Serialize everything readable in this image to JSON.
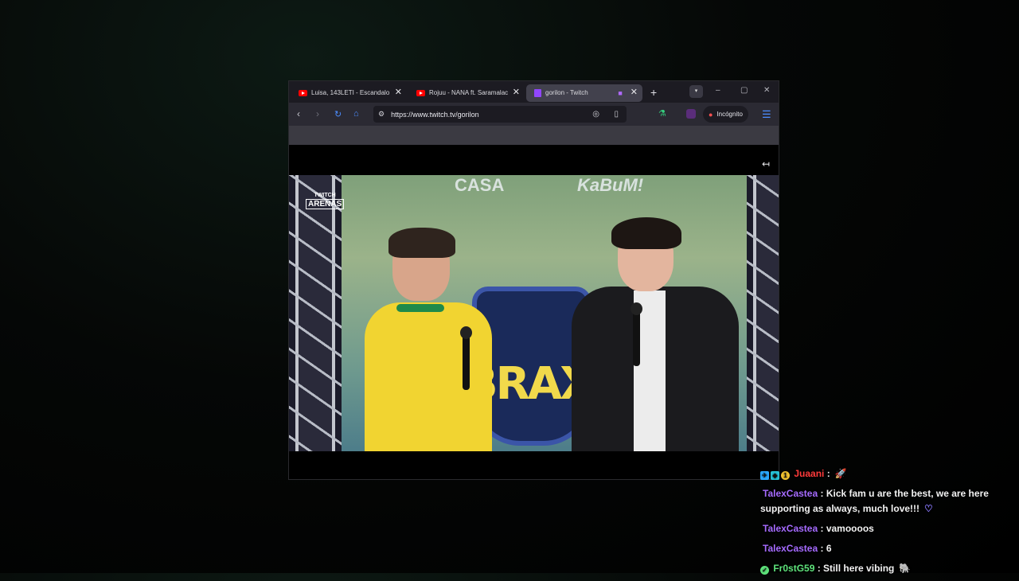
{
  "browser": {
    "tabs": [
      {
        "title": "Luisa, 143LETI - Escandalo (",
        "icon": "youtube-icon",
        "active": false
      },
      {
        "title": "Rojuu - NANA ft. Saramalac",
        "icon": "youtube-icon",
        "active": false
      },
      {
        "title": "gorilon - Twitch",
        "icon": "twitch-icon",
        "active": true
      }
    ],
    "new_tab_label": "+",
    "url": "https://www.twitch.tv/gorilon",
    "incognito_label": "Incógnito",
    "accent": "#4c8dff"
  },
  "stream": {
    "watermark_top": "TWITCH",
    "watermark_main": "ARENAS",
    "wall_text": "BRAX",
    "sponsor_1": "CASA",
    "sponsor_2": "KaBuM!"
  },
  "chat": {
    "messages": [
      {
        "user": "Juaani",
        "text": " :",
        "color": "#ff3b3b",
        "badges": [
          "badge-blue",
          "badge-cyan",
          "badge-gold"
        ],
        "emote": "🚀"
      },
      {
        "user": "TalexCastea",
        "text": " : Kick fam u are the best, we are here supporting as always, much love!!!",
        "color": "#a66bff",
        "emote": "♡"
      },
      {
        "user": "TalexCastea",
        "text": " : vamoooos",
        "color": "#a66bff"
      },
      {
        "user": "TalexCastea",
        "text": " : 6",
        "color": "#a66bff"
      },
      {
        "user": "Fr0stG59",
        "text": " : Still here vibing",
        "color": "#5ee37b",
        "badges": [
          "badge-green"
        ],
        "emote": "🐘"
      }
    ]
  }
}
